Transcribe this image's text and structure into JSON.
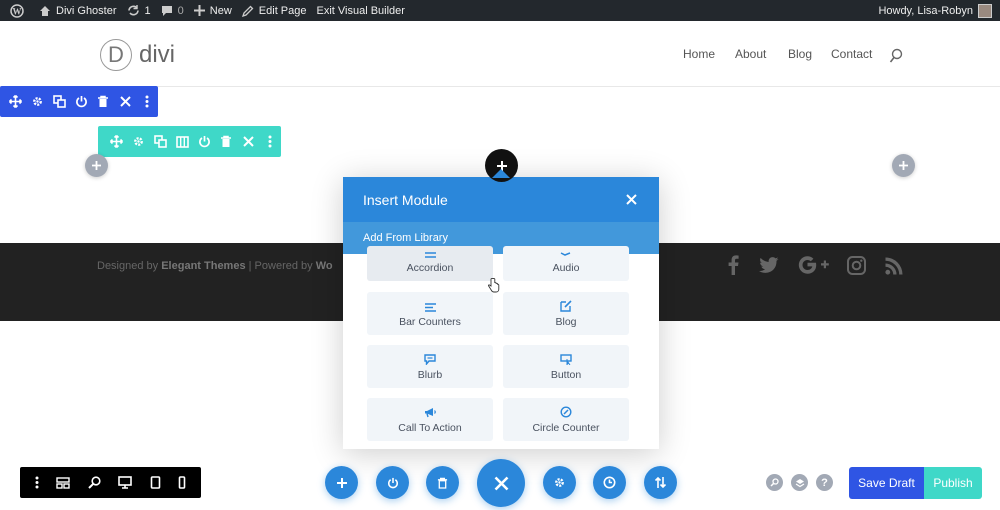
{
  "adminbar": {
    "site_name": "Divi Ghoster",
    "updates_count": "1",
    "comments_count": "0",
    "new_label": "New",
    "edit_label": "Edit Page",
    "exit_label": "Exit Visual Builder",
    "howdy": "Howdy, Lisa-Robyn"
  },
  "header": {
    "logo_letter": "D",
    "logo_text": "divi",
    "nav": [
      "Home",
      "About",
      "Blog",
      "Contact"
    ]
  },
  "footer": {
    "designed_by": "Designed by",
    "theme_name": "Elegant Themes",
    "powered_by": "| Powered by",
    "powered_name": "Wo"
  },
  "modal": {
    "title": "Insert Module",
    "subtab": "Add From Library",
    "modules": [
      "Accordion",
      "Audio",
      "Bar Counters",
      "Blog",
      "Blurb",
      "Button",
      "Call To Action",
      "Circle Counter"
    ]
  },
  "actions": {
    "save_draft": "Save Draft",
    "publish": "Publish"
  },
  "colors": {
    "section_toolbar": "#2f55e4",
    "row_toolbar": "#3fd8c8",
    "primary": "#2b87da",
    "save_draft": "#2f55e4",
    "publish": "#3fd8c8"
  }
}
